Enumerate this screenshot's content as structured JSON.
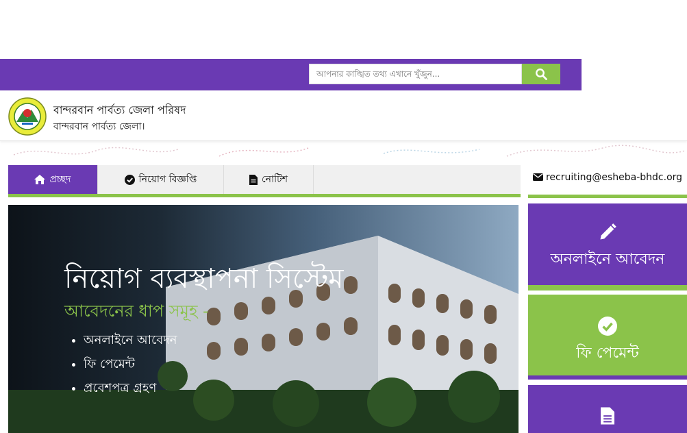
{
  "search": {
    "placeholder": "আপনার কাঙ্খিত তথ্য এখানে খুঁজুন..."
  },
  "header": {
    "title": "বান্দরবান পার্বত্য জেলা পরিষদ",
    "subtitle": "বান্দরবান পার্বত্য জেলা।"
  },
  "tabs": [
    {
      "label": "প্রচ্ছদ",
      "icon": "home-icon"
    },
    {
      "label": "নিয়োগ বিজ্ঞপ্তি",
      "icon": "check-circle-icon"
    },
    {
      "label": "নোটিশ",
      "icon": "file-icon"
    }
  ],
  "banner": {
    "title": "নিয়োগ ব্যবস্থাপনা সিস্টেম",
    "subtitle": "আবেদনের ধাপ সমূহ -",
    "steps": [
      "অনলাইনে আবেদন",
      "ফি পেমেন্ট",
      "প্রবেশপত্র গ্রহণ"
    ]
  },
  "sidebar": {
    "email": "recruiting@esheba-bhdc.org",
    "cards": [
      {
        "label": "অনলাইনে আবেদন",
        "icon": "pencil-icon"
      },
      {
        "label": "ফি পেমেন্ট",
        "icon": "check-circle-icon"
      },
      {
        "label": "",
        "icon": "file-icon"
      }
    ]
  },
  "colors": {
    "purple": "#6a3ab3",
    "green": "#8bc34a"
  }
}
